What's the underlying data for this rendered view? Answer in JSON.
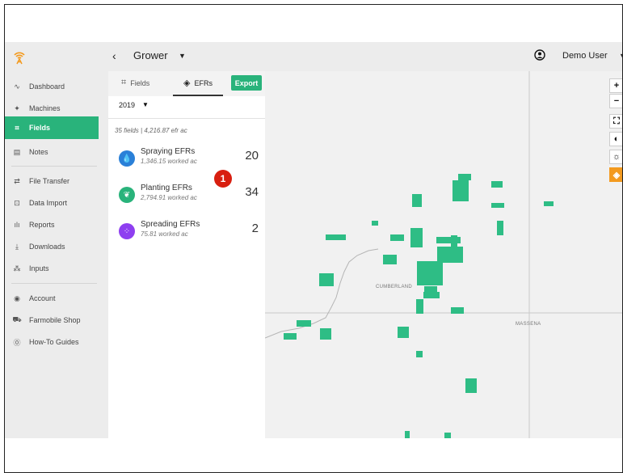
{
  "header": {
    "back_icon": "chevron-left-icon",
    "grower_label": "Grower",
    "user_name": "Demo User"
  },
  "sidebar": {
    "items": [
      {
        "label": "Dashboard",
        "icon": "activity-icon"
      },
      {
        "label": "Machines",
        "icon": "machine-icon"
      },
      {
        "label": "Fields",
        "icon": "field-icon"
      },
      {
        "label": "Notes",
        "icon": "notes-icon"
      },
      {
        "label": "File Transfer",
        "icon": "transfer-icon"
      },
      {
        "label": "Data Import",
        "icon": "import-icon"
      },
      {
        "label": "Reports",
        "icon": "reports-icon"
      },
      {
        "label": "Downloads",
        "icon": "download-icon"
      },
      {
        "label": "Inputs",
        "icon": "inputs-icon"
      },
      {
        "label": "Account",
        "icon": "account-icon"
      },
      {
        "label": "Farmobile Shop",
        "icon": "cart-icon"
      },
      {
        "label": "How-To Guides",
        "icon": "help-icon"
      }
    ],
    "active": "Fields"
  },
  "panel": {
    "tabs": [
      {
        "label": "Fields",
        "icon": "field-outline-icon"
      },
      {
        "label": "EFRs",
        "icon": "layers-icon"
      }
    ],
    "export_label": "Export",
    "year": "2019",
    "summary": "35 fields | 4,216.87 efr ac",
    "efrs": [
      {
        "name": "Spraying EFRs",
        "sub": "1,346.15 worked ac",
        "count": "20",
        "color": "#2a80d8",
        "icon": "droplet-icon"
      },
      {
        "name": "Planting EFRs",
        "sub": "2,794.91 worked ac",
        "count": "34",
        "color": "#29b37b",
        "icon": "leaf-icon"
      },
      {
        "name": "Spreading EFRs",
        "sub": "75.81 worked ac",
        "count": "2",
        "color": "#8e3ff0",
        "icon": "spread-icon"
      }
    ]
  },
  "annotation": {
    "badge": "1"
  },
  "map": {
    "towns": [
      "CUMBERLAND",
      "MASSENA"
    ],
    "controls": {
      "zoom_in": "+",
      "zoom_out": "−"
    },
    "field_color": "#2ebd85"
  }
}
